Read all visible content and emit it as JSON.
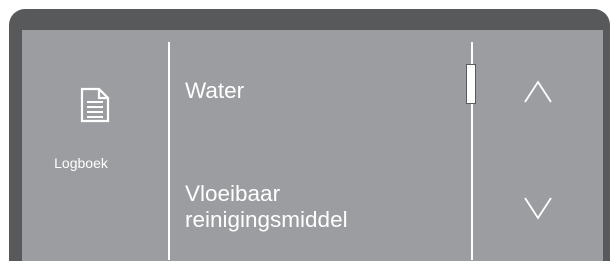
{
  "sidebar": {
    "icon": "document-icon",
    "label": "Logboek"
  },
  "list": {
    "items": [
      {
        "label": "Water"
      },
      {
        "label_line1": "Vloeibaar",
        "label_line2": "reinigingsmiddel"
      }
    ]
  },
  "navigation": {
    "up_icon": "chevron-up-icon",
    "down_icon": "chevron-down-icon"
  },
  "colors": {
    "bezel": "#58595b",
    "screen": "#9b9da0",
    "text": "#ffffff"
  }
}
